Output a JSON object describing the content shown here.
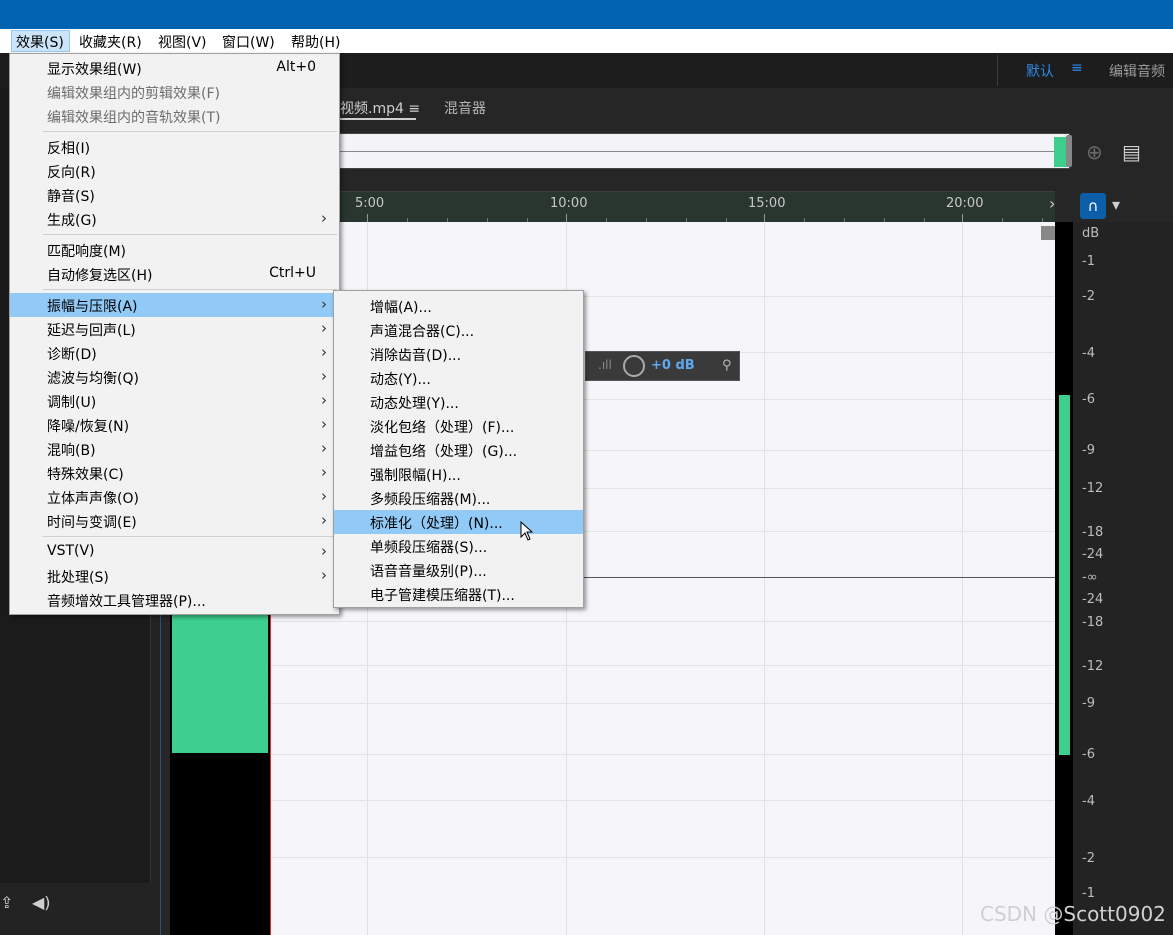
{
  "menubar": {
    "items": [
      "效果(S)",
      "收藏夹(R)",
      "视图(V)",
      "窗口(W)",
      "帮助(H)"
    ]
  },
  "workspace": {
    "default_label": "默认",
    "menu_icon": "hamburger-icon",
    "edit_label": "编辑音频"
  },
  "editor": {
    "tab_file": "视频.mp4",
    "tab_file_menu_icon": "hamburger-icon",
    "tab_mixer": "混音器",
    "ruler_ticks": [
      "5:00",
      "10:00",
      "15:00",
      "20:00"
    ],
    "db_scale": [
      "dB",
      "-1",
      "-2",
      "-4",
      "-6",
      "-9",
      "-12",
      "-18",
      "-24",
      "-∞",
      "-24",
      "-18",
      "-12",
      "-9",
      "-6",
      "-4",
      "-2",
      "-1"
    ]
  },
  "hud": {
    "value": "+0 dB",
    "icons": [
      "level-meter-icon",
      "volume-knob-icon",
      "pin-icon"
    ]
  },
  "effects_menu": {
    "items": [
      {
        "label": "显示效果组(W)",
        "shortcut": "Alt+0"
      },
      {
        "label": "编辑效果组内的剪辑效果(F)",
        "disabled": true
      },
      {
        "label": "编辑效果组内的音轨效果(T)",
        "disabled": true
      },
      {
        "label": "反相(I)"
      },
      {
        "label": "反向(R)"
      },
      {
        "label": "静音(S)"
      },
      {
        "label": "生成(G)",
        "submenu": true
      },
      {
        "label": "匹配响度(M)"
      },
      {
        "label": "自动修复选区(H)",
        "shortcut": "Ctrl+U"
      },
      {
        "label": "振幅与压限(A)",
        "submenu": true,
        "highlighted": true
      },
      {
        "label": "延迟与回声(L)",
        "submenu": true
      },
      {
        "label": "诊断(D)",
        "submenu": true
      },
      {
        "label": "滤波与均衡(Q)",
        "submenu": true
      },
      {
        "label": "调制(U)",
        "submenu": true
      },
      {
        "label": "降噪/恢复(N)",
        "submenu": true
      },
      {
        "label": "混响(B)",
        "submenu": true
      },
      {
        "label": "特殊效果(C)",
        "submenu": true
      },
      {
        "label": "立体声声像(O)",
        "submenu": true
      },
      {
        "label": "时间与变调(E)",
        "submenu": true
      },
      {
        "label": "VST(V)",
        "submenu": true
      },
      {
        "label": "批处理(S)",
        "submenu": true
      },
      {
        "label": "音频增效工具管理器(P)..."
      }
    ]
  },
  "amplitude_submenu": {
    "items": [
      {
        "label": "增幅(A)..."
      },
      {
        "label": "声道混合器(C)..."
      },
      {
        "label": "消除齿音(D)..."
      },
      {
        "label": "动态(Y)..."
      },
      {
        "label": "动态处理(Y)..."
      },
      {
        "label": "淡化包络（处理）(F)..."
      },
      {
        "label": "增益包络（处理）(G)..."
      },
      {
        "label": "强制限幅(H)..."
      },
      {
        "label": "多频段压缩器(M)..."
      },
      {
        "label": "标准化（处理）(N)...",
        "highlighted": true
      },
      {
        "label": "单频段压缩器(S)..."
      },
      {
        "label": "语音音量级别(P)..."
      },
      {
        "label": "电子管建模压缩器(T)..."
      }
    ]
  },
  "watermark": "CSDN @Scott0902"
}
